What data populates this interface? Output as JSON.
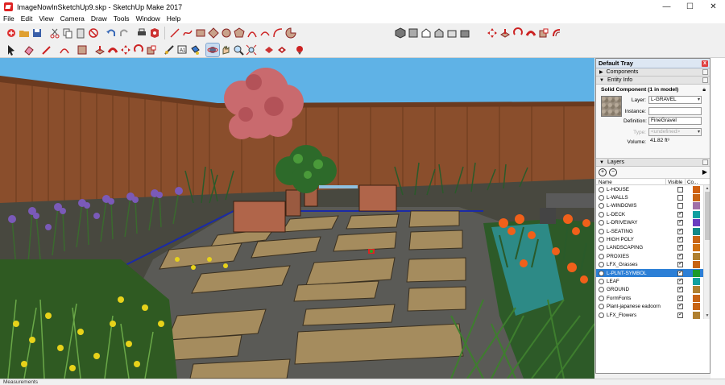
{
  "window": {
    "title": "ImageNowInSketchUp9.skp - SketchUp Make 2017",
    "minimize": "—",
    "maximize": "☐",
    "close": "✕"
  },
  "menu": [
    "File",
    "Edit",
    "View",
    "Camera",
    "Draw",
    "Tools",
    "Window",
    "Help"
  ],
  "toolbar1": [
    "new-file-icon",
    "open-icon",
    "save-icon",
    "cut-icon",
    "copy-icon",
    "paste-icon",
    "erase-icon",
    "undo-icon",
    "redo-icon",
    "print-icon",
    "model-info-icon",
    "line-icon",
    "freehand-icon",
    "rectangle-icon",
    "circle-icon",
    "polygon-icon",
    "arc-icon",
    "two-point-arc-icon",
    "three-point-arc-icon",
    "pie-icon",
    "iso-view-icon",
    "top-view-icon",
    "front-view-icon",
    "right-view-icon",
    "back-view-icon",
    "left-view-icon",
    "move-icon",
    "push-pull-icon",
    "rotate-icon",
    "follow-me-icon",
    "scale-icon",
    "offset-icon"
  ],
  "toolbar2": [
    "select-icon",
    "eraser-icon",
    "pencil-icon",
    "arc-tool-icon",
    "shapes-icon",
    "push-pull-tool-icon",
    "follow-me-tool-icon",
    "move-tool-icon",
    "rotate-tool-icon",
    "scale-tool-icon",
    "tape-measure-icon",
    "text-icon",
    "paint-bucket-icon",
    "orbit-icon",
    "pan-icon",
    "zoom-icon",
    "zoom-extents-icon",
    "warehouse-icon",
    "extension-warehouse-icon",
    "section-icon"
  ],
  "tray": {
    "title": "Default Tray",
    "close": "x",
    "components_label": "Components",
    "entity_info_label": "Entity Info",
    "entity": {
      "name": "Solid Component (1 in model)",
      "layer_label": "Layer:",
      "layer_value": "L-GRAVEL",
      "instance_label": "Instance:",
      "instance_value": "",
      "definition_label": "Definition:",
      "definition_value": "FineGravel",
      "type_label": "Type:",
      "type_value": "<undefined>",
      "volume_label": "Volume:",
      "volume_value": "41.82 ft³"
    },
    "layers_label": "Layers",
    "layers_cols": {
      "name": "Name",
      "visible": "Visible",
      "color": "Co..."
    },
    "layers": [
      {
        "name": "L-HOUSE",
        "visible": false,
        "color": "#d06010"
      },
      {
        "name": "L-WALLS",
        "visible": false,
        "color": "#c86414"
      },
      {
        "name": "L-WINDOWS",
        "visible": false,
        "color": "#a070a8"
      },
      {
        "name": "L-DECK",
        "visible": true,
        "color": "#10a0a0"
      },
      {
        "name": "L-DRIVEWAY",
        "visible": true,
        "color": "#6a3cc0"
      },
      {
        "name": "L-SEATING",
        "visible": true,
        "color": "#108888"
      },
      {
        "name": "HIGH POLY",
        "visible": true,
        "color": "#c86414"
      },
      {
        "name": "LANDSCAPING",
        "visible": true,
        "color": "#d07010"
      },
      {
        "name": "PROXIES",
        "visible": true,
        "color": "#b08030"
      },
      {
        "name": "LFX_Grasses",
        "visible": true,
        "color": "#c86414"
      },
      {
        "name": "L-PLNT-SYMBOL",
        "visible": true,
        "color": "#1a9a2a",
        "selected": true
      },
      {
        "name": "LEAF",
        "visible": true,
        "color": "#10a0a0"
      },
      {
        "name": "GROUND",
        "visible": true,
        "color": "#b08030"
      },
      {
        "name": "FormFonts",
        "visible": true,
        "color": "#c86414"
      },
      {
        "name": "Plant-japanese eadoorn",
        "visible": true,
        "color": "#c86414"
      },
      {
        "name": "LFX_Flowers",
        "visible": true,
        "color": "#b08030"
      }
    ]
  },
  "status": {
    "measurements_label": "Measurements"
  }
}
